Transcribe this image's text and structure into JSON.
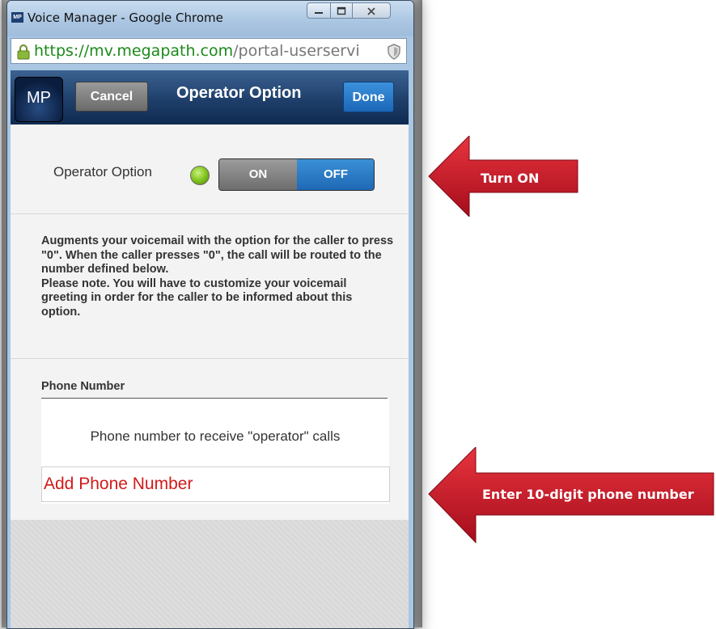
{
  "window": {
    "title": "Voice Manager - Google Chrome",
    "icon_label": "MP",
    "controls": [
      "minimize",
      "maximize",
      "close"
    ]
  },
  "address_bar": {
    "url_host": "https://mv.megapath.com",
    "url_path": "/portal-userservi"
  },
  "header": {
    "logo": "MP",
    "cancel_label": "Cancel",
    "title": "Operator Option",
    "done_label": "Done"
  },
  "operator_option": {
    "label": "Operator Option",
    "toggle_on": "ON",
    "toggle_off": "OFF",
    "selected": "OFF"
  },
  "description": "Augments your voicemail with the option for the caller to press \"0\". When the caller presses \"0\", the call will be routed to the number defined below.\nPlease note. You will have to customize your voicemail greeting in order for the caller to be informed about this option.",
  "phone": {
    "section_label": "Phone Number",
    "help_text": "Phone number to receive \"operator\" calls",
    "placeholder": "Add Phone Number"
  },
  "annotations": {
    "turn_on": "Turn ON",
    "enter_phone": "Enter 10-digit phone number",
    "arrow_color": "#c8102e"
  }
}
